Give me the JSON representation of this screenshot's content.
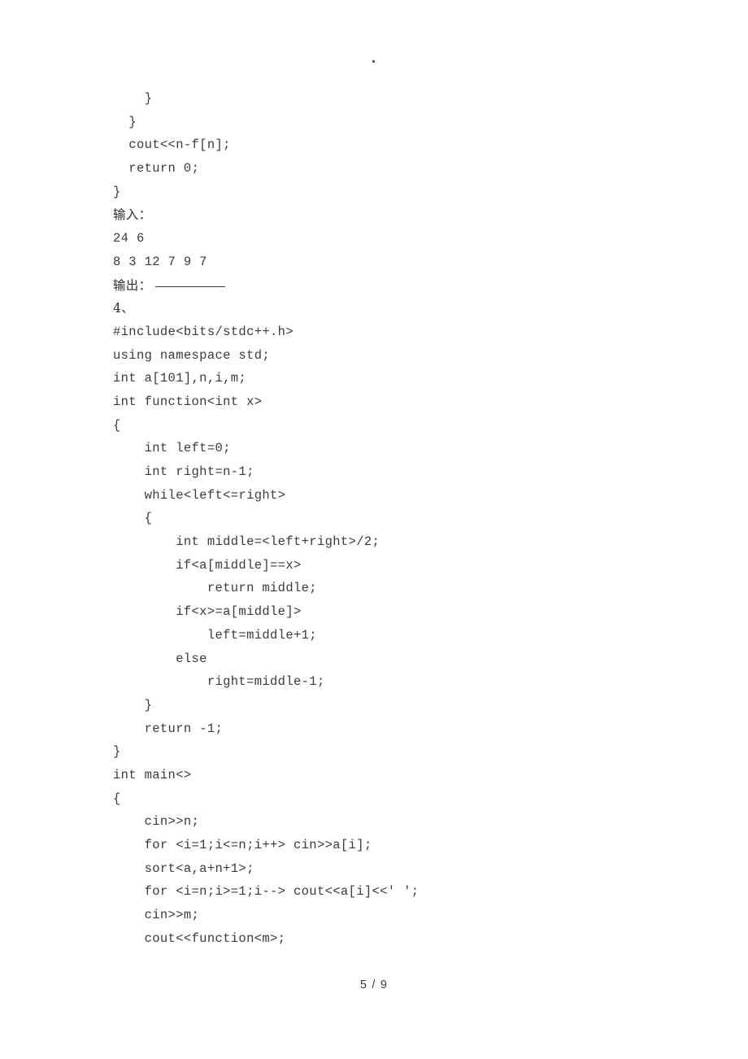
{
  "document": {
    "kind": "scanned-exam-page",
    "stray_mark": ".",
    "footer": "5 / 9"
  },
  "body_lines": [
    {
      "text": "    }",
      "type": "code"
    },
    {
      "text": "  }",
      "type": "code"
    },
    {
      "text": "  cout<<n-f[n];",
      "type": "code"
    },
    {
      "text": "  return 0;",
      "type": "code"
    },
    {
      "text": "}",
      "type": "code"
    },
    {
      "text": "输入：",
      "type": "cjk"
    },
    {
      "text": "24 6",
      "type": "code"
    },
    {
      "text": "8 3 12 7 9 7",
      "type": "code"
    },
    {
      "text": "输出：",
      "type": "cjk-blank"
    },
    {
      "text": "4、",
      "type": "cjk"
    },
    {
      "text": "#include<bits/stdc++.h>",
      "type": "code"
    },
    {
      "text": "using namespace std;",
      "type": "code"
    },
    {
      "text": "int a[101],n,i,m;",
      "type": "code"
    },
    {
      "text": "int function<int x>",
      "type": "code"
    },
    {
      "text": "{",
      "type": "code"
    },
    {
      "text": "    int left=0;",
      "type": "code"
    },
    {
      "text": "    int right=n-1;",
      "type": "code"
    },
    {
      "text": "    while<left<=right>",
      "type": "code"
    },
    {
      "text": "    {",
      "type": "code"
    },
    {
      "text": "        int middle=<left+right>/2;",
      "type": "code"
    },
    {
      "text": "        if<a[middle]==x>",
      "type": "code"
    },
    {
      "text": "            return middle;",
      "type": "code"
    },
    {
      "text": "        if<x>=a[middle]>",
      "type": "code"
    },
    {
      "text": "            left=middle+1;",
      "type": "code"
    },
    {
      "text": "        else",
      "type": "code"
    },
    {
      "text": "            right=middle-1;",
      "type": "code"
    },
    {
      "text": "    }",
      "type": "code"
    },
    {
      "text": "    return -1;",
      "type": "code"
    },
    {
      "text": "}",
      "type": "code"
    },
    {
      "text": "int main<>",
      "type": "code"
    },
    {
      "text": "{",
      "type": "code"
    },
    {
      "text": "    cin>>n;",
      "type": "code"
    },
    {
      "text": "    for <i=1;i<=n;i++> cin>>a[i];",
      "type": "code"
    },
    {
      "text": "    sort<a,a+n+1>;",
      "type": "code"
    },
    {
      "text": "    for <i=n;i>=1;i--> cout<<a[i]<<' ';",
      "type": "code"
    },
    {
      "text": "    cin>>m;",
      "type": "code"
    },
    {
      "text": "    cout<<function<m>;",
      "type": "code"
    }
  ],
  "colors": {
    "page_background": "#ffffff",
    "text": "#3b3b3b",
    "cjk_text": "#2f2f2f"
  }
}
